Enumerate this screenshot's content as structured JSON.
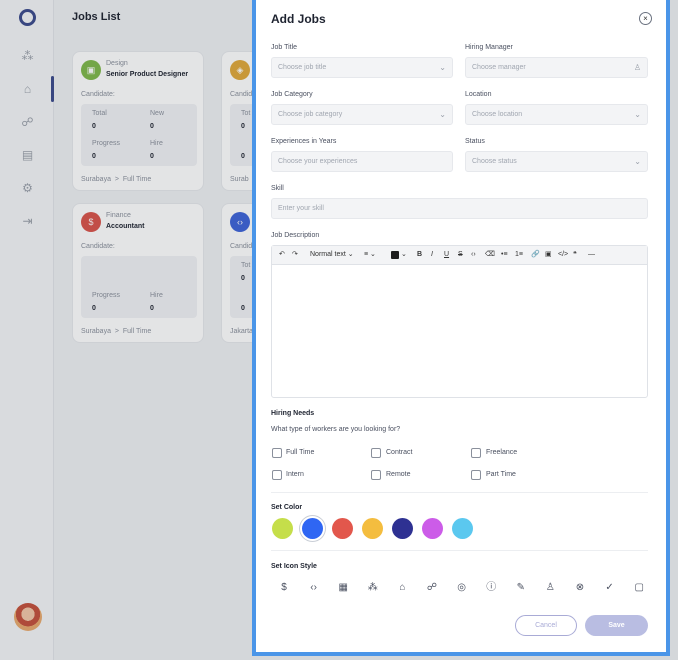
{
  "app": {
    "page_title": "Jobs List",
    "sidebar_icons": [
      "users-icon",
      "briefcase-icon",
      "people-icon",
      "layers-icon",
      "settings-icon",
      "logout-icon"
    ],
    "cards": [
      {
        "category": "Design",
        "role": "Senior Product Designer",
        "candidate_label": "Candidate:",
        "total_label": "Total",
        "total": "0",
        "new_label": "New",
        "new": "0",
        "progress_label": "Progress",
        "progress": "0",
        "hire_label": "Hire",
        "hire": "0",
        "location": "Surabaya",
        "sep": ">",
        "type": "Full Time",
        "color": "#7fb84a",
        "glyph": "▣"
      },
      {
        "category": "Finance",
        "role": "Accountant",
        "candidate_label": "Candidate:",
        "progress_label": "Progress",
        "progress": "0",
        "hire_label": "Hire",
        "hire": "0",
        "location": "Surabaya",
        "sep": ">",
        "type": "Full Time",
        "color": "#d9534a",
        "glyph": "$"
      },
      {
        "cut_total_label": "Tot",
        "total": "0",
        "progress": "0",
        "location_cut": "Surab",
        "candidate_label_cut": "Candid",
        "color": "#e0a83a",
        "glyph": "◈"
      },
      {
        "cut_total_label": "Tot",
        "total": "0",
        "progress": "0",
        "location_cut": "Jakarta",
        "candidate_label_cut": "Candid",
        "color": "#3d63d8",
        "glyph": "‹›"
      }
    ]
  },
  "modal": {
    "title": "Add Jobs",
    "close_glyph": "×",
    "job_title": {
      "label": "Job Title",
      "placeholder": "Choose job title"
    },
    "hiring_manager": {
      "label": "Hiring Manager",
      "placeholder": "Choose manager"
    },
    "job_category": {
      "label": "Job Category",
      "placeholder": "Choose job category"
    },
    "location": {
      "label": "Location",
      "placeholder": "Choose location"
    },
    "experience": {
      "label": "Experiences in Years",
      "placeholder": "Choose your experiences"
    },
    "status": {
      "label": "Status",
      "placeholder": "Choose status"
    },
    "skill": {
      "label": "Skill",
      "placeholder": "Enter your skill"
    },
    "description": {
      "label": "Job Description",
      "toolbar": {
        "undo": "↶",
        "redo": "↷",
        "text_style": "Normal text ⌄",
        "line_height": "≡ ⌄",
        "color_chev": "⌄",
        "bold": "B",
        "italic": "I",
        "underline": "U",
        "strike": "S",
        "code": "‹›",
        "clear": "⌫",
        "bullets": "•≡",
        "numbers": "1≡",
        "link": "🔗",
        "image": "▣",
        "codeblock": "</>",
        "quote": "❝",
        "hr": "—"
      }
    },
    "hiring_needs": {
      "title": "Hiring Needs",
      "subtitle": "What type of workers are you looking for?",
      "options": [
        "Full Time",
        "Contract",
        "Freelance",
        "Intern",
        "Remote",
        "Part Time"
      ]
    },
    "set_color": {
      "title": "Set Color",
      "colors": [
        "#c5de4a",
        "#2f66f3",
        "#e2574c",
        "#f4bd3f",
        "#2e3192",
        "#cc5ce8",
        "#5bc8ef"
      ],
      "selected_index": 1
    },
    "set_icon": {
      "title": "Set Icon Style",
      "icons": [
        {
          "name": "dollar-icon",
          "glyph": "$"
        },
        {
          "name": "code-icon",
          "glyph": "‹›"
        },
        {
          "name": "chart-icon",
          "glyph": "▦"
        },
        {
          "name": "team-icon",
          "glyph": "⁂"
        },
        {
          "name": "briefcase-icon",
          "glyph": "⌂"
        },
        {
          "name": "users-icon",
          "glyph": "☍"
        },
        {
          "name": "lifebuoy-icon",
          "glyph": "◎"
        },
        {
          "name": "info-icon",
          "glyph": "ⓘ"
        },
        {
          "name": "pen-icon",
          "glyph": "✎"
        },
        {
          "name": "person-icon",
          "glyph": "♙"
        },
        {
          "name": "cancel-circle-icon",
          "glyph": "⊗"
        },
        {
          "name": "check-circle-icon",
          "glyph": "✓"
        },
        {
          "name": "note-icon",
          "glyph": "▢"
        }
      ]
    },
    "cancel_label": "Cancel",
    "save_label": "Save"
  }
}
